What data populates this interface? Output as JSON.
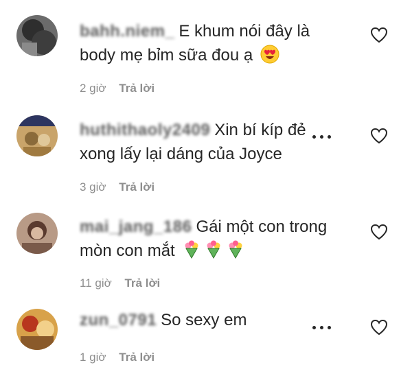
{
  "comments": [
    {
      "username": "bahh.niem_",
      "text": "E khum nói đây là body mẹ bỉm sữa đou ạ",
      "emoji_icon": "heart-eyes-emoji",
      "time": "2 giờ",
      "reply_label": "Trả lời",
      "has_more_menu": false,
      "liked": false
    },
    {
      "username": "huthithaoly2409",
      "text": "Xin bí kíp đẻ xong lấy lại dáng của Joyce",
      "emoji_icon": "",
      "time": "3 giờ",
      "reply_label": "Trả lời",
      "has_more_menu": true,
      "liked": false
    },
    {
      "username": "mai_jang_186",
      "text": "Gái một con trong mòn con mắt",
      "emoji_icon": "bouquet-emoji x3",
      "time": "11 giờ",
      "reply_label": "Trả lời",
      "has_more_menu": false,
      "liked": false
    },
    {
      "username": "zun_0791",
      "text": "So sexy em",
      "emoji_icon": "",
      "time": "1 giờ",
      "reply_label": "Trả lời",
      "has_more_menu": true,
      "liked": false
    }
  ],
  "colors": {
    "text": "#262626",
    "secondary": "#8e8e8e"
  }
}
